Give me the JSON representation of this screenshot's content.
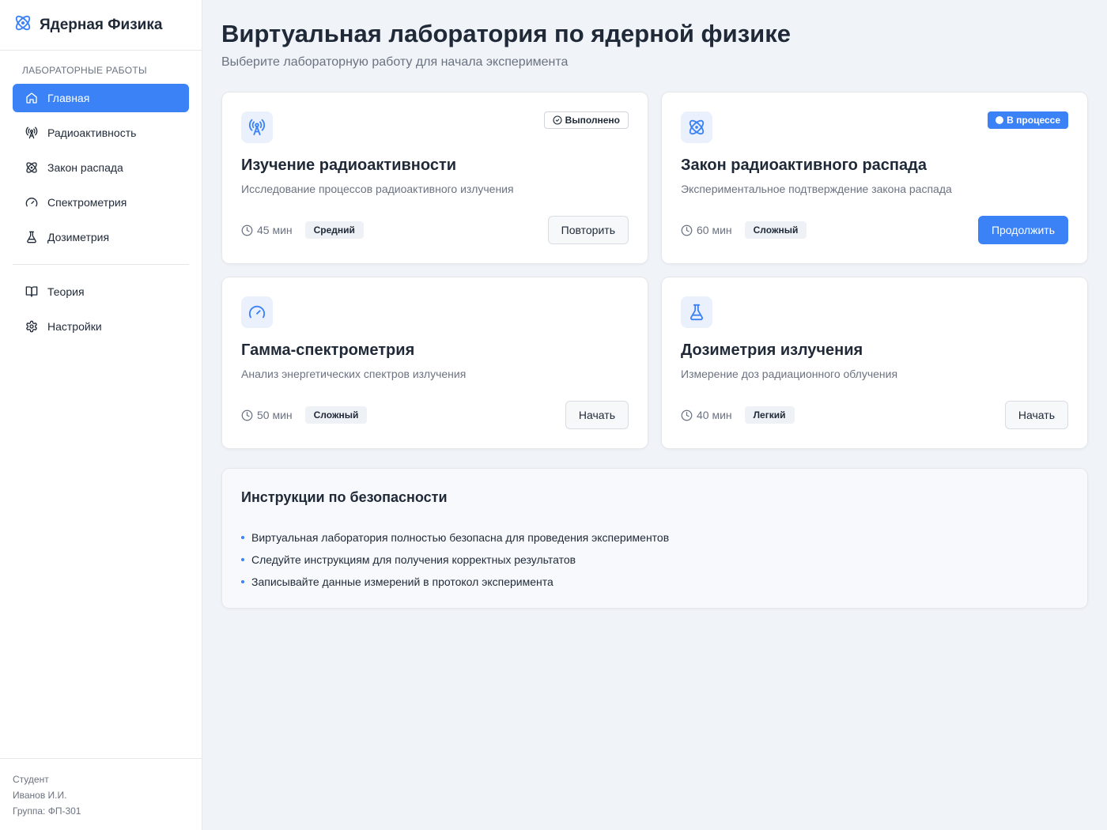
{
  "app": {
    "title": "Ядерная Физика",
    "accent": "#3b82f6"
  },
  "sidebar": {
    "section_label": "ЛАБОРАТОРНЫЕ РАБОТЫ",
    "items": [
      {
        "label": "Главная",
        "icon": "home-icon",
        "active": true
      },
      {
        "label": "Радиоактивность",
        "icon": "radio-tower-icon"
      },
      {
        "label": "Закон распада",
        "icon": "atom-icon"
      },
      {
        "label": "Спектрометрия",
        "icon": "gauge-icon"
      },
      {
        "label": "Дозиметрия",
        "icon": "flask-icon"
      }
    ],
    "secondary_items": [
      {
        "label": "Теория",
        "icon": "book-icon"
      },
      {
        "label": "Настройки",
        "icon": "gear-icon"
      }
    ],
    "footer": {
      "role": "Студент",
      "name": "Иванов И.И.",
      "group": "Группа: ФП-301"
    }
  },
  "main": {
    "title": "Виртуальная лаборатория по ядерной физике",
    "subtitle": "Выберите лабораторную работу для начала эксперимента",
    "labs": [
      {
        "title": "Изучение радиоактивности",
        "description": "Исследование процессов радиоактивного излучения",
        "duration": "45 мин",
        "level": "Средний",
        "status": "Выполнено",
        "button": "Повторить",
        "icon": "radio-tower-icon"
      },
      {
        "title": "Закон радиоактивного распада",
        "description": "Экспериментальное подтверждение закона распада",
        "duration": "60 мин",
        "level": "Сложный",
        "status": "В процессе",
        "button": "Продолжить",
        "icon": "atom-icon"
      },
      {
        "title": "Гамма-спектрометрия",
        "description": "Анализ энергетических спектров излучения",
        "duration": "50 мин",
        "level": "Сложный",
        "status": "",
        "button": "Начать",
        "icon": "gauge-icon"
      },
      {
        "title": "Дозиметрия излучения",
        "description": "Измерение доз радиационного облучения",
        "duration": "40 мин",
        "level": "Легкий",
        "status": "",
        "button": "Начать",
        "icon": "flask-icon"
      }
    ],
    "safety": {
      "title": "Инструкции по безопасности",
      "items": [
        "Виртуальная лаборатория полностью безопасна для проведения экспериментов",
        "Следуйте инструкциям для получения корректных результатов",
        "Записывайте данные измерений в протокол эксперимента"
      ]
    }
  }
}
